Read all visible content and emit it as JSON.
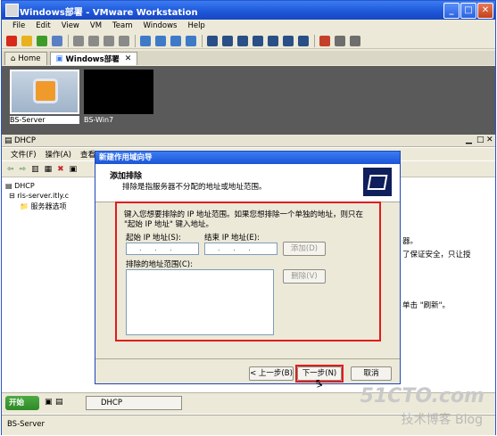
{
  "window": {
    "title": "Windows部署 - VMware Workstation"
  },
  "menubar": [
    "File",
    "Edit",
    "View",
    "VM",
    "Team",
    "Windows",
    "Help"
  ],
  "tabs": [
    {
      "label": "Home"
    },
    {
      "label": "Windows部署"
    }
  ],
  "thumbnails": [
    {
      "label": "BS-Server"
    },
    {
      "label": "BS-Win7"
    }
  ],
  "dhcp": {
    "title": "DHCP",
    "menu": [
      "文件(F)",
      "操作(A)",
      "查看"
    ],
    "tree": {
      "root": "DHCP",
      "server": "ris-server.itly.c",
      "child": "服务器选项"
    },
    "right_text": [
      "器。",
      "了保证安全，只让授",
      "单击 \"刷新\"。"
    ]
  },
  "wizard": {
    "title": "新建作用域向导",
    "heading": "添加排除",
    "subheading": "排除是指服务器不分配的地址或地址范围。",
    "instructions": "键入您想要排除的 IP 地址范围。如果您想排除一个单独的地址，则只在 \"起始 IP 地址\" 键入地址。",
    "start_ip_label": "起始 IP 地址(S):",
    "end_ip_label": "结束 IP 地址(E):",
    "ip_placeholder": ". . .",
    "add_button": "添加(D)",
    "excluded_label": "排除的地址范围(C):",
    "remove_button": "删除(V)",
    "back_button": "< 上一步(B)",
    "next_button": "下一步(N) >",
    "cancel_button": "取消"
  },
  "taskbar": {
    "start": "开始",
    "task": "DHCP"
  },
  "statusbar": {
    "vm": "BS-Server"
  },
  "watermark": {
    "site": "51CTO.com",
    "blog": "技术博客  Blog"
  },
  "colors": {
    "highlight": "#e01c1c",
    "xp_blue": "#1d55d6"
  }
}
